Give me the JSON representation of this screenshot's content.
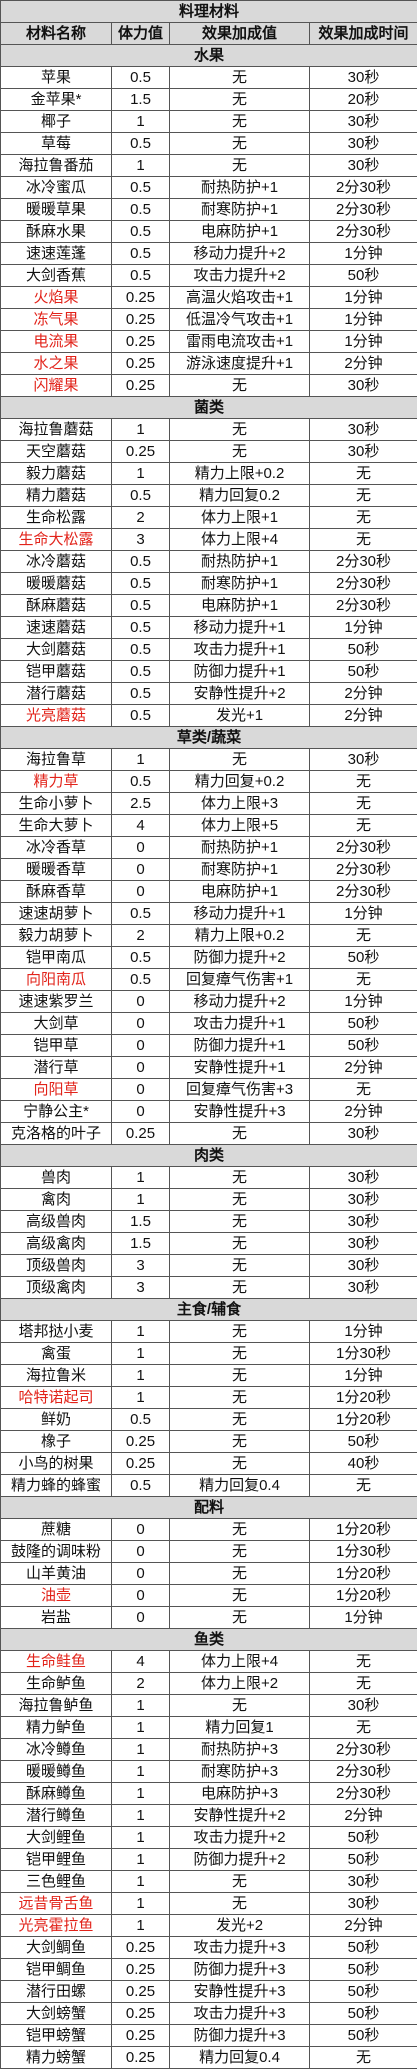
{
  "title": "料理材料",
  "headers": [
    "材料名称",
    "体力值",
    "效果加成值",
    "效果加成时间"
  ],
  "colors": {
    "header_bg": "#d9d9d9",
    "highlight_text": "#e2231a",
    "border": "#555555"
  },
  "sections": [
    {
      "name": "水果",
      "rows": [
        [
          "苹果",
          "0.5",
          "无",
          "30秒",
          false
        ],
        [
          "金苹果*",
          "1.5",
          "无",
          "20秒",
          false
        ],
        [
          "椰子",
          "1",
          "无",
          "30秒",
          false
        ],
        [
          "草莓",
          "0.5",
          "无",
          "30秒",
          false
        ],
        [
          "海拉鲁番茄",
          "1",
          "无",
          "30秒",
          false
        ],
        [
          "冰冷蜜瓜",
          "0.5",
          "耐热防护+1",
          "2分30秒",
          false
        ],
        [
          "暖暖草果",
          "0.5",
          "耐寒防护+1",
          "2分30秒",
          false
        ],
        [
          "酥麻水果",
          "0.5",
          "电麻防护+1",
          "2分30秒",
          false
        ],
        [
          "速速莲蓬",
          "0.5",
          "移动力提升+2",
          "1分钟",
          false
        ],
        [
          "大剑香蕉",
          "0.5",
          "攻击力提升+2",
          "50秒",
          false
        ],
        [
          "火焰果",
          "0.25",
          "高温火焰攻击+1",
          "1分钟",
          true
        ],
        [
          "冻气果",
          "0.25",
          "低温冷气攻击+1",
          "1分钟",
          true
        ],
        [
          "电流果",
          "0.25",
          "雷雨电流攻击+1",
          "1分钟",
          true
        ],
        [
          "水之果",
          "0.25",
          "游泳速度提升+1",
          "2分钟",
          true
        ],
        [
          "闪耀果",
          "0.25",
          "无",
          "30秒",
          true
        ]
      ]
    },
    {
      "name": "菌类",
      "rows": [
        [
          "海拉鲁蘑菇",
          "1",
          "无",
          "30秒",
          false
        ],
        [
          "天空蘑菇",
          "0.25",
          "无",
          "30秒",
          false
        ],
        [
          "毅力蘑菇",
          "1",
          "精力上限+0.2",
          "无",
          false
        ],
        [
          "精力蘑菇",
          "0.5",
          "精力回复0.2",
          "无",
          false
        ],
        [
          "生命松露",
          "2",
          "体力上限+1",
          "无",
          false
        ],
        [
          "生命大松露",
          "3",
          "体力上限+4",
          "无",
          true
        ],
        [
          "冰冷蘑菇",
          "0.5",
          "耐热防护+1",
          "2分30秒",
          false
        ],
        [
          "暖暖蘑菇",
          "0.5",
          "耐寒防护+1",
          "2分30秒",
          false
        ],
        [
          "酥麻蘑菇",
          "0.5",
          "电麻防护+1",
          "2分30秒",
          false
        ],
        [
          "速速蘑菇",
          "0.5",
          "移动力提升+1",
          "1分钟",
          false
        ],
        [
          "大剑蘑菇",
          "0.5",
          "攻击力提升+1",
          "50秒",
          false
        ],
        [
          "铠甲蘑菇",
          "0.5",
          "防御力提升+1",
          "50秒",
          false
        ],
        [
          "潜行蘑菇",
          "0.5",
          "安静性提升+2",
          "2分钟",
          false
        ],
        [
          "光亮蘑菇",
          "0.5",
          "发光+1",
          "2分钟",
          true
        ]
      ]
    },
    {
      "name": "草类/蔬菜",
      "rows": [
        [
          "海拉鲁草",
          "1",
          "无",
          "30秒",
          false
        ],
        [
          "精力草",
          "0.5",
          "精力回复+0.2",
          "无",
          true
        ],
        [
          "生命小萝卜",
          "2.5",
          "体力上限+3",
          "无",
          false
        ],
        [
          "生命大萝卜",
          "4",
          "体力上限+5",
          "无",
          false
        ],
        [
          "冰冷香草",
          "0",
          "耐热防护+1",
          "2分30秒",
          false
        ],
        [
          "暖暖香草",
          "0",
          "耐寒防护+1",
          "2分30秒",
          false
        ],
        [
          "酥麻香草",
          "0",
          "电麻防护+1",
          "2分30秒",
          false
        ],
        [
          "速速胡萝卜",
          "0.5",
          "移动力提升+1",
          "1分钟",
          false
        ],
        [
          "毅力胡萝卜",
          "2",
          "精力上限+0.2",
          "无",
          false
        ],
        [
          "铠甲南瓜",
          "0.5",
          "防御力提升+2",
          "50秒",
          false
        ],
        [
          "向阳南瓜",
          "0.5",
          "回复瘴气伤害+1",
          "无",
          true
        ],
        [
          "速速紫罗兰",
          "0",
          "移动力提升+2",
          "1分钟",
          false
        ],
        [
          "大剑草",
          "0",
          "攻击力提升+1",
          "50秒",
          false
        ],
        [
          "铠甲草",
          "0",
          "防御力提升+1",
          "50秒",
          false
        ],
        [
          "潜行草",
          "0",
          "安静性提升+1",
          "2分钟",
          false
        ],
        [
          "向阳草",
          "0",
          "回复瘴气伤害+3",
          "无",
          true
        ],
        [
          "宁静公主*",
          "0",
          "安静性提升+3",
          "2分钟",
          false
        ],
        [
          "克洛格的叶子",
          "0.25",
          "无",
          "30秒",
          false
        ]
      ]
    },
    {
      "name": "肉类",
      "rows": [
        [
          "兽肉",
          "1",
          "无",
          "30秒",
          false
        ],
        [
          "禽肉",
          "1",
          "无",
          "30秒",
          false
        ],
        [
          "高级兽肉",
          "1.5",
          "无",
          "30秒",
          false
        ],
        [
          "高级禽肉",
          "1.5",
          "无",
          "30秒",
          false
        ],
        [
          "顶级兽肉",
          "3",
          "无",
          "30秒",
          false
        ],
        [
          "顶级禽肉",
          "3",
          "无",
          "30秒",
          false
        ]
      ]
    },
    {
      "name": "主食/辅食",
      "rows": [
        [
          "塔邦挞小麦",
          "1",
          "无",
          "1分钟",
          false
        ],
        [
          "禽蛋",
          "1",
          "无",
          "1分30秒",
          false
        ],
        [
          "海拉鲁米",
          "1",
          "无",
          "1分钟",
          false
        ],
        [
          "哈特诺起司",
          "1",
          "无",
          "1分20秒",
          true
        ],
        [
          "鲜奶",
          "0.5",
          "无",
          "1分20秒",
          false
        ],
        [
          "橡子",
          "0.25",
          "无",
          "50秒",
          false
        ],
        [
          "小鸟的树果",
          "0.25",
          "无",
          "40秒",
          false
        ],
        [
          "精力蜂的蜂蜜",
          "0.5",
          "精力回复0.4",
          "无",
          false
        ]
      ]
    },
    {
      "name": "配料",
      "rows": [
        [
          "蔗糖",
          "0",
          "无",
          "1分20秒",
          false
        ],
        [
          "鼓隆的调味粉",
          "0",
          "无",
          "1分30秒",
          false
        ],
        [
          "山羊黄油",
          "0",
          "无",
          "1分20秒",
          false
        ],
        [
          "油壶",
          "0",
          "无",
          "1分20秒",
          true
        ],
        [
          "岩盐",
          "0",
          "无",
          "1分钟",
          false
        ]
      ]
    },
    {
      "name": "鱼类",
      "rows": [
        [
          "生命鲑鱼",
          "4",
          "体力上限+4",
          "无",
          true
        ],
        [
          "生命鲈鱼",
          "2",
          "体力上限+2",
          "无",
          false
        ],
        [
          "海拉鲁鲈鱼",
          "1",
          "无",
          "30秒",
          false
        ],
        [
          "精力鲈鱼",
          "1",
          "精力回复1",
          "无",
          false
        ],
        [
          "冰冷鳟鱼",
          "1",
          "耐热防护+3",
          "2分30秒",
          false
        ],
        [
          "暖暖鳟鱼",
          "1",
          "耐寒防护+3",
          "2分30秒",
          false
        ],
        [
          "酥麻鳟鱼",
          "1",
          "电麻防护+3",
          "2分30秒",
          false
        ],
        [
          "潜行鳟鱼",
          "1",
          "安静性提升+2",
          "2分钟",
          false
        ],
        [
          "大剑鲤鱼",
          "1",
          "攻击力提升+2",
          "50秒",
          false
        ],
        [
          "铠甲鲤鱼",
          "1",
          "防御力提升+2",
          "50秒",
          false
        ],
        [
          "三色鲤鱼",
          "1",
          "无",
          "30秒",
          false
        ],
        [
          "远昔骨舌鱼",
          "1",
          "无",
          "30秒",
          true
        ],
        [
          "光亮霍拉鱼",
          "1",
          "发光+2",
          "2分钟",
          true
        ],
        [
          "大剑鲷鱼",
          "0.25",
          "攻击力提升+3",
          "50秒",
          false
        ],
        [
          "铠甲鲷鱼",
          "0.25",
          "防御力提升+3",
          "50秒",
          false
        ],
        [
          "潜行田螺",
          "0.25",
          "安静性提升+3",
          "50秒",
          false
        ],
        [
          "大剑螃蟹",
          "0.25",
          "攻击力提升+3",
          "50秒",
          false
        ],
        [
          "铠甲螃蟹",
          "0.25",
          "防御力提升+3",
          "50秒",
          false
        ],
        [
          "精力螃蟹",
          "0.25",
          "精力回复0.4",
          "无",
          false
        ]
      ]
    }
  ]
}
